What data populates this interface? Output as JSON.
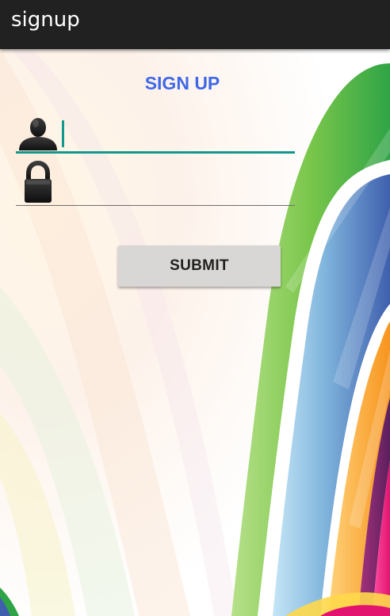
{
  "action_bar": {
    "title": "signup",
    "background": "#212121"
  },
  "form": {
    "heading": "SIGN UP",
    "heading_color": "#3f68e8",
    "username": {
      "icon": "user-icon",
      "value": "",
      "focused": true
    },
    "password": {
      "icon": "lock-icon",
      "value": ""
    },
    "submit_label": "SUBMIT"
  },
  "colors": {
    "accent": "#11998e",
    "button_bg": "#d8d7d5"
  }
}
